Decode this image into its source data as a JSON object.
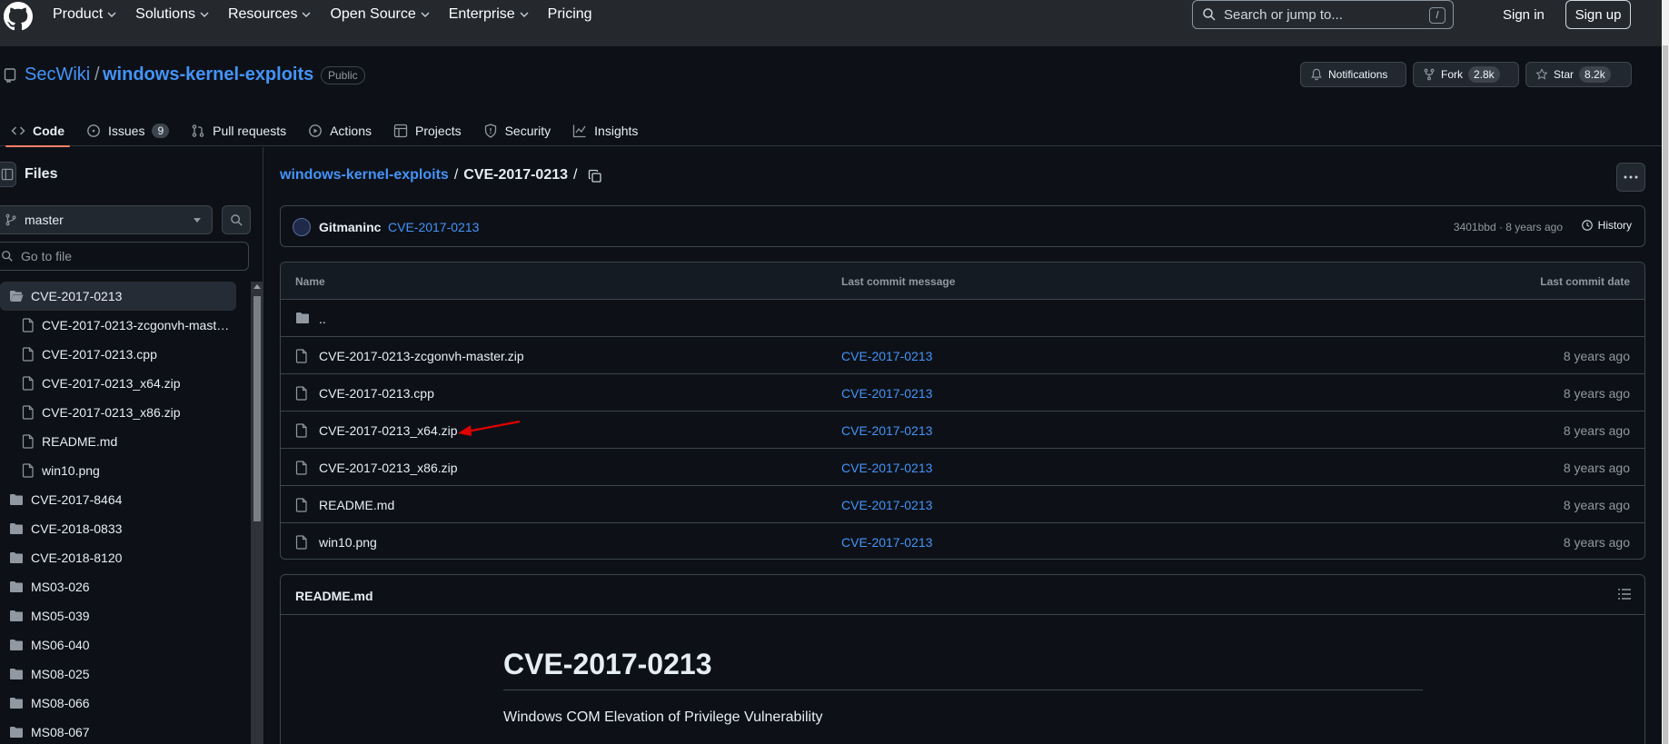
{
  "header": {
    "nav": [
      "Product",
      "Solutions",
      "Resources",
      "Open Source",
      "Enterprise",
      "Pricing"
    ],
    "search_placeholder": "Search or jump to...",
    "search_shortcut": "/",
    "sign_in": "Sign in",
    "sign_up": "Sign up"
  },
  "repo": {
    "owner": "SecWiki",
    "separator": "/",
    "name": "windows-kernel-exploits",
    "visibility": "Public",
    "notifications_label": "Notifications",
    "fork_label": "Fork",
    "fork_count": "2.8k",
    "star_label": "Star",
    "star_count": "8.2k"
  },
  "tabs": [
    {
      "label": "Code",
      "icon": "code-icon"
    },
    {
      "label": "Issues",
      "icon": "issue-icon",
      "count": "9"
    },
    {
      "label": "Pull requests",
      "icon": "pull-request-icon"
    },
    {
      "label": "Actions",
      "icon": "play-icon"
    },
    {
      "label": "Projects",
      "icon": "table-icon"
    },
    {
      "label": "Security",
      "icon": "shield-icon"
    },
    {
      "label": "Insights",
      "icon": "graph-icon"
    }
  ],
  "sidebar": {
    "title": "Files",
    "branch": "master",
    "goto_placeholder": "Go to file",
    "tree": [
      {
        "label": "CVE-2017-0213",
        "type": "folder-open",
        "level": 0,
        "selected": true
      },
      {
        "label": "CVE-2017-0213-zcgonvh-mast…",
        "type": "file",
        "level": 1
      },
      {
        "label": "CVE-2017-0213.cpp",
        "type": "file",
        "level": 1
      },
      {
        "label": "CVE-2017-0213_x64.zip",
        "type": "file",
        "level": 1
      },
      {
        "label": "CVE-2017-0213_x86.zip",
        "type": "file",
        "level": 1
      },
      {
        "label": "README.md",
        "type": "file",
        "level": 1
      },
      {
        "label": "win10.png",
        "type": "file",
        "level": 1
      },
      {
        "label": "CVE-2017-8464",
        "type": "folder",
        "level": 0
      },
      {
        "label": "CVE-2018-0833",
        "type": "folder",
        "level": 0
      },
      {
        "label": "CVE-2018-8120",
        "type": "folder",
        "level": 0
      },
      {
        "label": "MS03-026",
        "type": "folder",
        "level": 0
      },
      {
        "label": "MS05-039",
        "type": "folder",
        "level": 0
      },
      {
        "label": "MS06-040",
        "type": "folder",
        "level": 0
      },
      {
        "label": "MS08-025",
        "type": "folder",
        "level": 0
      },
      {
        "label": "MS08-066",
        "type": "folder",
        "level": 0
      },
      {
        "label": "MS08-067",
        "type": "folder",
        "level": 0
      }
    ]
  },
  "breadcrumb": {
    "repo": "windows-kernel-exploits",
    "sep1": "/",
    "current": "CVE-2017-0213",
    "sep2": "/"
  },
  "commit": {
    "author": "Gitmaninc",
    "message": "CVE-2017-0213",
    "meta": "3401bbd · 8 years ago",
    "history": "History"
  },
  "table": {
    "headers": {
      "name": "Name",
      "message": "Last commit message",
      "date": "Last commit date"
    },
    "parent": "..",
    "rows": [
      {
        "name": "CVE-2017-0213-zcgonvh-master.zip",
        "message": "CVE-2017-0213",
        "date": "8 years ago"
      },
      {
        "name": "CVE-2017-0213.cpp",
        "message": "CVE-2017-0213",
        "date": "8 years ago"
      },
      {
        "name": "CVE-2017-0213_x64.zip",
        "message": "CVE-2017-0213",
        "date": "8 years ago"
      },
      {
        "name": "CVE-2017-0213_x86.zip",
        "message": "CVE-2017-0213",
        "date": "8 years ago"
      },
      {
        "name": "README.md",
        "message": "CVE-2017-0213",
        "date": "8 years ago"
      },
      {
        "name": "win10.png",
        "message": "CVE-2017-0213",
        "date": "8 years ago"
      }
    ]
  },
  "readme": {
    "filename": "README.md",
    "heading": "CVE-2017-0213",
    "description": "Windows COM Elevation of Privilege Vulnerability"
  },
  "colors": {
    "background": "#0d1117",
    "header": "#25292e",
    "link": "#4493f8",
    "accent_underline": "#f78166",
    "annotation_arrow": "#e00000"
  }
}
